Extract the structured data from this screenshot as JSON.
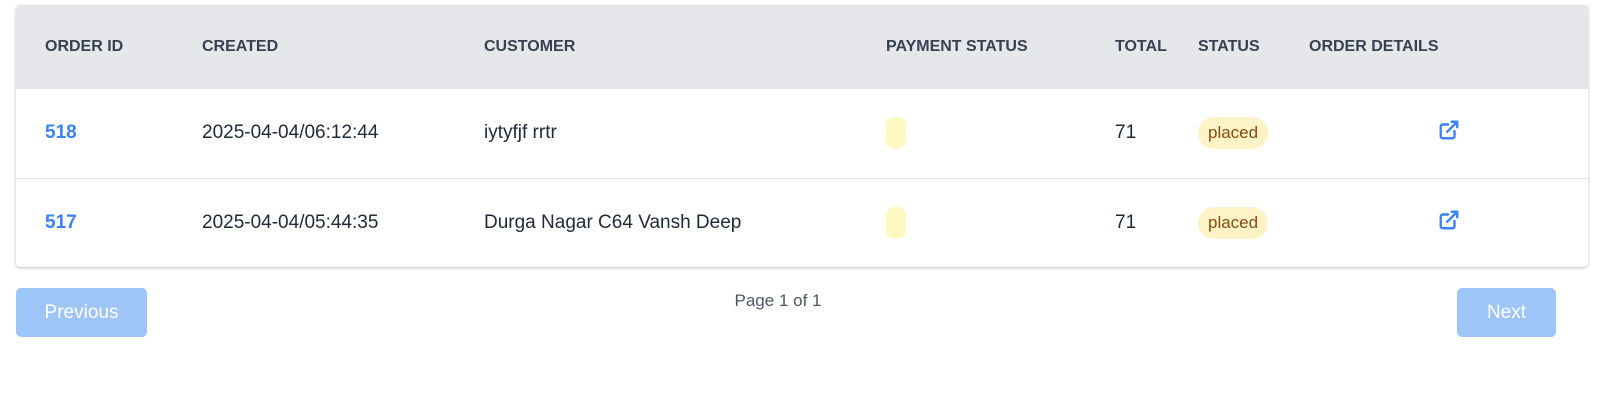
{
  "table": {
    "headers": {
      "order_id": "ORDER ID",
      "created": "CREATED",
      "customer": "CUSTOMER",
      "payment_status": "PAYMENT STATUS",
      "total": "TOTAL",
      "status": "STATUS",
      "order_details": "ORDER DETAILS"
    },
    "rows": [
      {
        "order_id": "518",
        "created": "2025-04-04/06:12:44",
        "customer": "iytyfjf rrtr",
        "payment_status": "",
        "total": "71",
        "status": "placed"
      },
      {
        "order_id": "517",
        "created": "2025-04-04/05:44:35",
        "customer": "Durga Nagar C64 Vansh Deep",
        "payment_status": "",
        "total": "71",
        "status": "placed"
      }
    ]
  },
  "pagination": {
    "previous_label": "Previous",
    "page_info": "Page 1 of 1",
    "next_label": "Next"
  },
  "colors": {
    "link": "#3b82f6",
    "header_bg": "#e5e7eb",
    "status_badge_bg": "#fef3c7",
    "button_bg": "#9ec5f8"
  },
  "icons": {
    "order_details": "external-link-icon"
  }
}
